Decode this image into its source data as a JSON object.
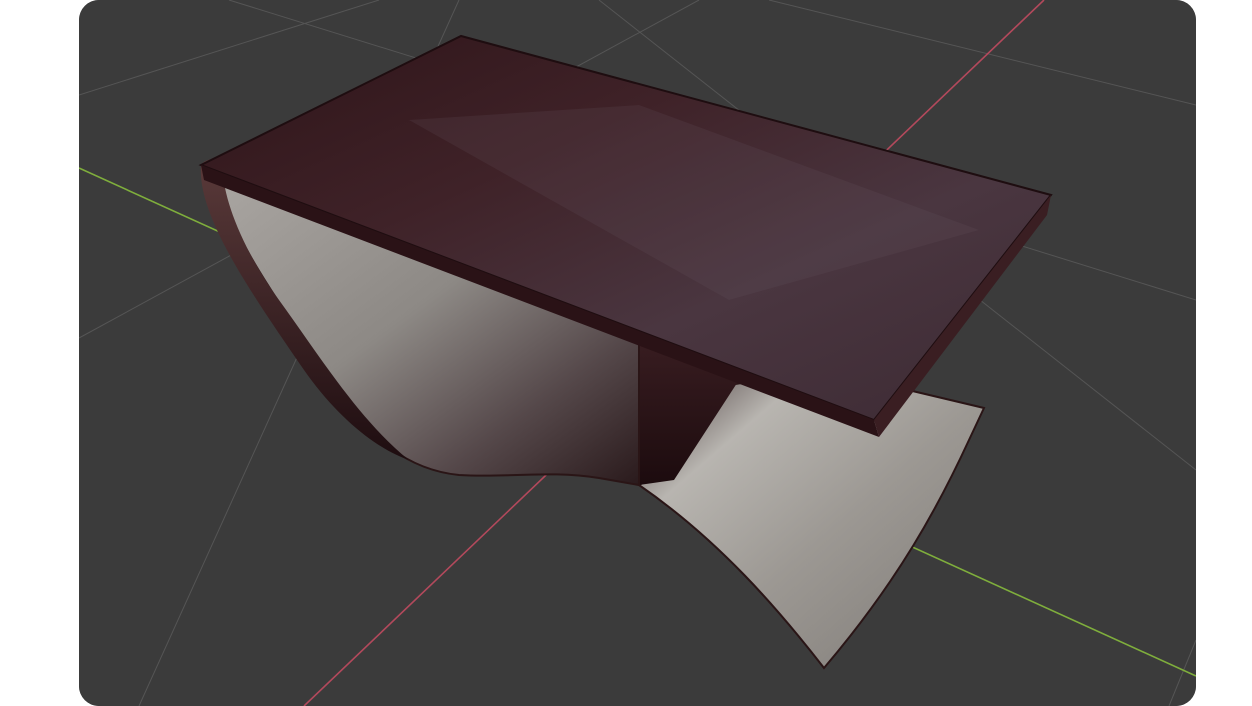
{
  "viewport": {
    "background_color": "#3b3b3b",
    "grid_line_color": "#555555",
    "x_axis_color": "#b3495c",
    "y_axis_color": "#7fae3c"
  },
  "model": {
    "name": "coffee-table",
    "wood_color": "#3a1c20",
    "metal_color": "#8c8985"
  }
}
